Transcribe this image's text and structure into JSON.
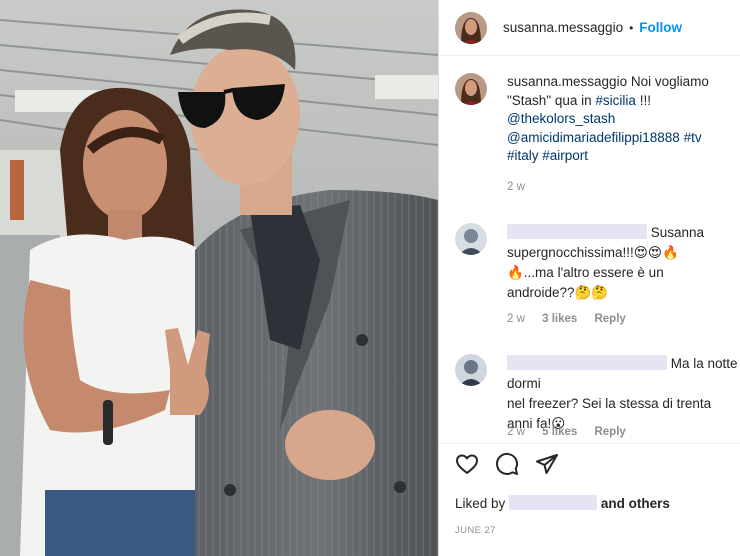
{
  "post": {
    "username": "susanna.messaggio",
    "separator": "•",
    "follow_label": "Follow",
    "caption": {
      "username": "susanna.messaggio",
      "text_before": "Noi vogliamo \"Stash\" qua in",
      "tag_sicilia": "#sicilia",
      "text_after": "!!!",
      "mention_1": "@thekolors_stash",
      "mention_2": "@amicidimariadefilippi18888",
      "tag_tv": "#tv",
      "tag_italy": "#italy",
      "tag_airport": "#airport",
      "time": "2 w"
    },
    "comments": [
      {
        "line_1": "Susanna",
        "line_2": "supergnocchissima!!!😍😍🔥",
        "line_3": "🔥...ma l'altro essere è un",
        "line_4": "androide??🤔🤔",
        "time": "2 w",
        "likes": "3 likes",
        "reply": "Reply"
      },
      {
        "line_1": "Ma la notte dormi",
        "line_2": "nel freezer? Sei la stessa di trenta",
        "line_3": "anni fa!😮",
        "time": "2 w",
        "likes": "5 likes",
        "reply": "Reply"
      }
    ],
    "actions": {
      "liked_by_prefix": "Liked by",
      "liked_by_suffix": "and others"
    },
    "date": "JUNE 27"
  },
  "colors": {
    "follow_blue": "#0095f6",
    "link_blue": "#00376b",
    "muted": "#8e8e8e",
    "redaction": "#e6e3f5"
  },
  "icons": [
    "heart-icon",
    "comment-icon",
    "share-icon",
    "like-comment-icon"
  ]
}
